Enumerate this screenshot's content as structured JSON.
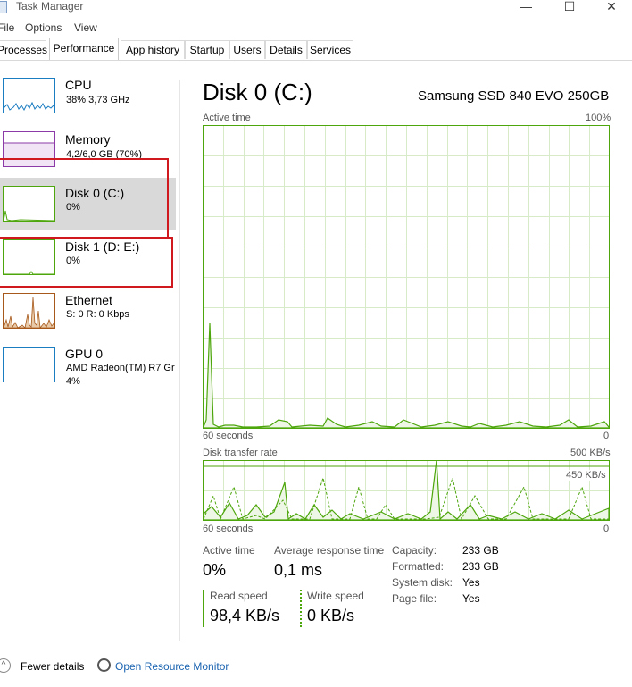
{
  "window": {
    "title": "Task Manager",
    "minimize": "—",
    "maximize": "☐",
    "close": "✕"
  },
  "menu": [
    "File",
    "Options",
    "View"
  ],
  "tabs": [
    "Processes",
    "Performance",
    "App history",
    "Startup",
    "Users",
    "Details",
    "Services"
  ],
  "active_tab": "Performance",
  "sidebar": {
    "items": [
      {
        "title": "CPU",
        "sub1": "38%  3,73 GHz",
        "sub2": "",
        "color": "#1a7cc1"
      },
      {
        "title": "Memory",
        "sub1": "4,2/6,0 GB (70%)",
        "sub2": "",
        "color": "#8b3aa8"
      },
      {
        "title": "Disk 0 (C:)",
        "sub1": "0%",
        "sub2": "",
        "color": "#4da60c"
      },
      {
        "title": "Disk 1 (D: E:)",
        "sub1": "0%",
        "sub2": "",
        "color": "#4da60c"
      },
      {
        "title": "Ethernet",
        "sub1": "S: 0  R: 0 Kbps",
        "sub2": "",
        "color": "#a7591b"
      },
      {
        "title": "GPU 0",
        "sub1": "AMD Radeon(TM) R7 Gr",
        "sub2": "4%",
        "color": "#1a7cc1"
      }
    ],
    "selected": "Disk 0 (C:)"
  },
  "main": {
    "disk_title": "Disk 0 (C:)",
    "disk_model": "Samsung SSD 840 EVO 250GB",
    "active_graph": {
      "label": "Active time",
      "max": "100%",
      "time": "60 seconds",
      "min": "0"
    },
    "rate_graph": {
      "label": "Disk transfer rate",
      "max": "500 KB/s",
      "line_label": "450 KB/s",
      "time": "60 seconds",
      "min": "0"
    },
    "stats": {
      "active_time_label": "Active time",
      "active_time_value": "0%",
      "avg_response_label": "Average response time",
      "avg_response_value": "0,1 ms",
      "read_speed_label": "Read speed",
      "read_speed_value": "98,4 KB/s",
      "write_speed_label": "Write speed",
      "write_speed_value": "0 KB/s"
    },
    "properties": [
      {
        "key": "Capacity:",
        "value": "233 GB"
      },
      {
        "key": "Formatted:",
        "value": "233 GB"
      },
      {
        "key": "System disk:",
        "value": "Yes"
      },
      {
        "key": "Page file:",
        "value": "Yes"
      }
    ]
  },
  "footer": {
    "fewer_details": "Fewer details",
    "open_monitor": "Open Resource Monitor"
  },
  "colors": {
    "disk_green": "#4da60c",
    "grid": "#d7ebc8",
    "highlight_red": "#d0191e",
    "link_blue": "#1a63b0"
  }
}
